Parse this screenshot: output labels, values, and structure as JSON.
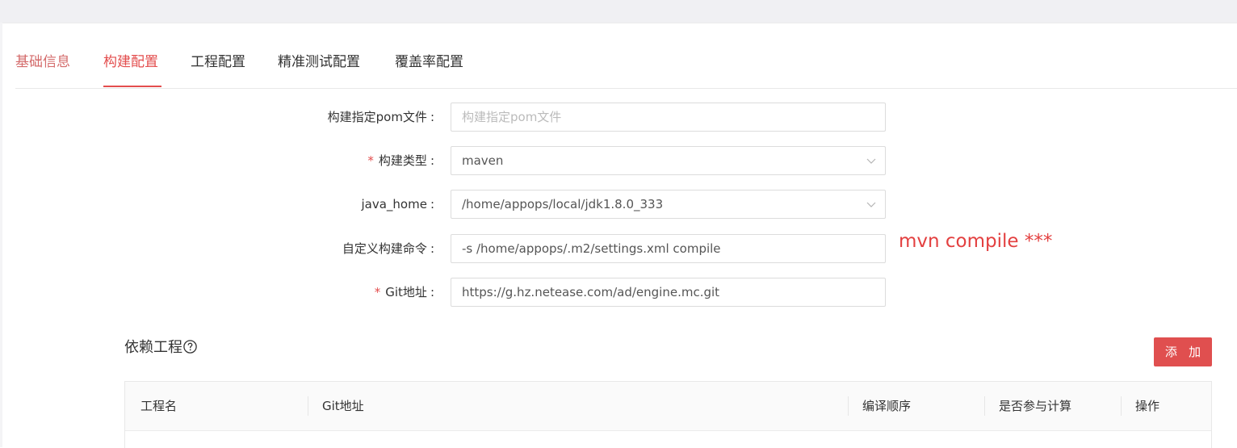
{
  "tabs": [
    {
      "label": "基础信息"
    },
    {
      "label": "构建配置"
    },
    {
      "label": "工程配置"
    },
    {
      "label": "精准测试配置"
    },
    {
      "label": "覆盖率配置"
    }
  ],
  "active_tab": "构建配置",
  "form": {
    "pom": {
      "label": "构建指定pom文件",
      "value": "",
      "placeholder": "构建指定pom文件",
      "required": false
    },
    "build_type": {
      "label": "构建类型",
      "value": "maven",
      "required": true
    },
    "java_home": {
      "label": "java_home",
      "value": "/home/appops/local/jdk1.8.0_333",
      "required": false
    },
    "custom_cmd": {
      "label": "自定义构建命令",
      "value": "-s /home/appops/.m2/settings.xml compile",
      "required": false
    },
    "git": {
      "label": "Git地址",
      "value": "https://g.hz.netease.com/ad/engine.mc.git",
      "required": true
    },
    "colon": ":",
    "required_mark": "*"
  },
  "annotation": "mvn compile ***",
  "dependencies": {
    "title": "依赖工程",
    "add_button": "添 加",
    "columns": [
      "工程名",
      "Git地址",
      "编译顺序",
      "是否参与计算",
      "操作"
    ]
  },
  "colors": {
    "accent": "#e34d4d",
    "button": "#e04f4f"
  }
}
